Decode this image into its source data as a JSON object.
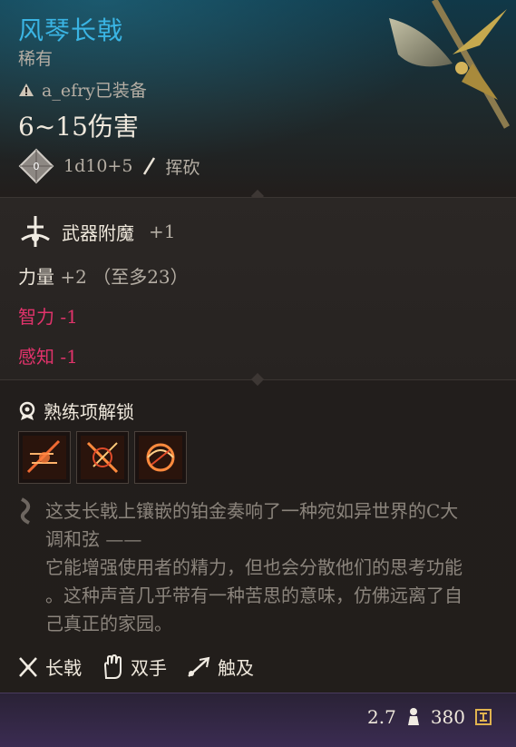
{
  "item": {
    "name": "风琴长戟",
    "rarity": "稀有",
    "equipped_by": "a_efry已装备",
    "damage": "6~15伤害",
    "dice": "1d10+5",
    "damage_type": "挥砍"
  },
  "enchant": {
    "label": "武器附魔",
    "bonus": "+1"
  },
  "stats": [
    {
      "name": "力量",
      "value": "+2 （至多23）"
    },
    {
      "name": "智力 -1"
    },
    {
      "name": "感知 -1"
    }
  ],
  "proficiency": {
    "title": "熟练项解锁",
    "skills": [
      "skill-slash-icon",
      "skill-rush-icon",
      "skill-whirl-icon"
    ]
  },
  "lore": {
    "lines": [
      "这支长戟上镶嵌的铂金奏响了一种宛如异世界的C大",
      "调和弦 ——",
      "它能增强使用者的精力，但也会分散他们的思考功能",
      "。这种声音几乎带有一种苦思的意味，仿佛远离了自",
      "己真正的家园。"
    ]
  },
  "tags": [
    {
      "label": "长戟",
      "icon": "halberd-icon"
    },
    {
      "label": "双手",
      "icon": "two-handed-icon"
    },
    {
      "label": "触及",
      "icon": "reach-icon"
    }
  ],
  "footer": {
    "weight": "2.7",
    "value": "380"
  },
  "colors": {
    "title": "#3ab4e3",
    "negative": "#e1336b",
    "muted": "#b5aea4"
  }
}
